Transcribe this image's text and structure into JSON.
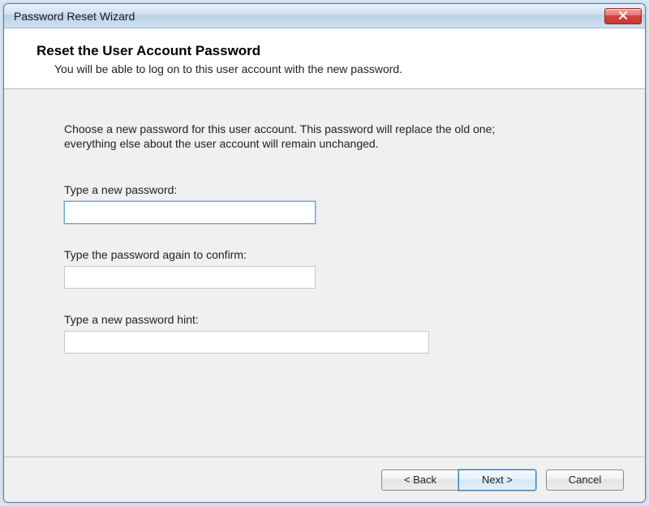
{
  "window": {
    "title": "Password Reset Wizard"
  },
  "header": {
    "title": "Reset the User Account Password",
    "subtitle": "You will be able to log on to this user account with the new password."
  },
  "body": {
    "intro": "Choose a new password for this user account. This password will replace the old one; everything else about the user account will remain unchanged.",
    "new_password_label": "Type a new password:",
    "confirm_password_label": "Type the password again to confirm:",
    "hint_label": "Type a new password hint:",
    "new_password_value": "",
    "confirm_password_value": "",
    "hint_value": ""
  },
  "footer": {
    "back_label": "< Back",
    "next_label": "Next >",
    "cancel_label": "Cancel"
  }
}
